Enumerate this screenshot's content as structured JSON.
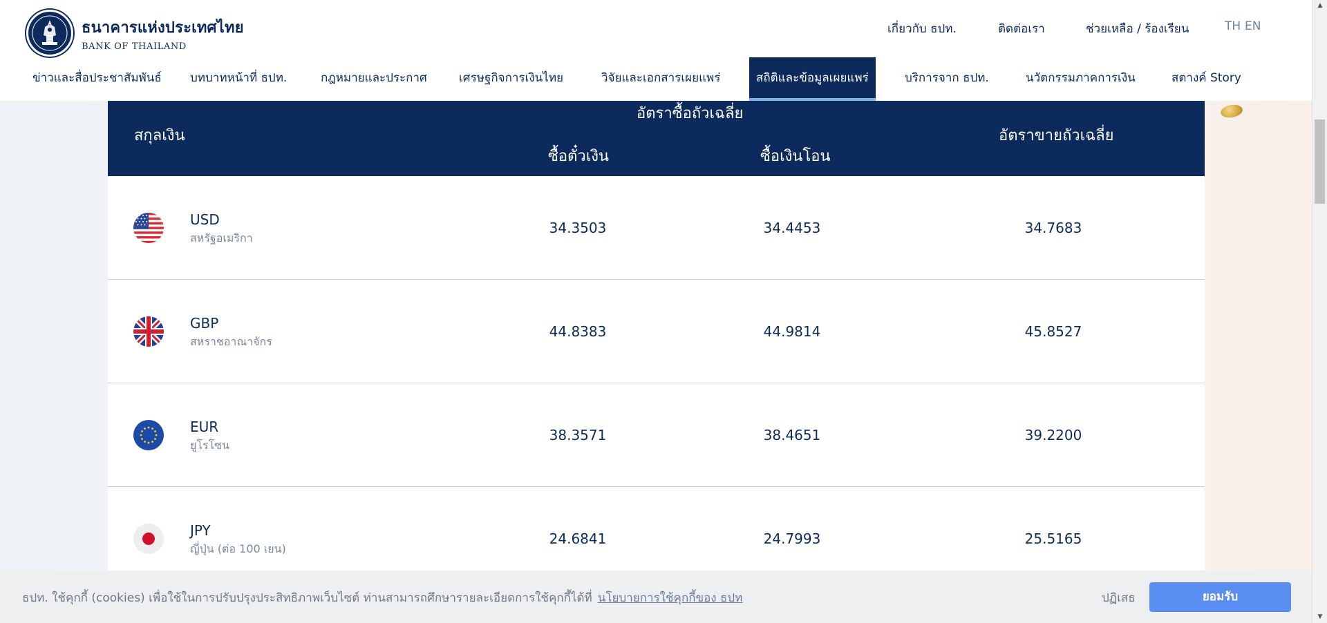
{
  "header": {
    "logo_th": "ธนาคารแห่งประเทศไทย",
    "logo_en": "BANK OF THAILAND",
    "top_links": [
      "เกี่ยวกับ ธปท.",
      "ติดต่อเรา",
      "ช่วยเหลือ / ร้องเรียน"
    ],
    "lang_th": "TH",
    "lang_en": "EN"
  },
  "nav": {
    "items": [
      "ข่าวและสื่อประชาสัมพันธ์",
      "บทบาทหน้าที่ ธปท.",
      "กฎหมายและประกาศ",
      "เศรษฐกิจการเงินไทย",
      "วิจัยและเอกสารเผยแพร่",
      "สถิติและข้อมูลเผยแพร่",
      "บริการจาก ธปท.",
      "นวัตกรรมภาคการเงิน",
      "สตางค์ Story"
    ],
    "active_index": 5
  },
  "table": {
    "headers": {
      "currency": "สกุลเงิน",
      "avg_buying": "อัตราซื้อถัวเฉลี่ย",
      "sight_bill": "ซื้อตั๋วเงิน",
      "transfer": "ซื้อเงินโอน",
      "avg_selling": "อัตราขายถัวเฉลี่ย"
    },
    "rows": [
      {
        "code": "USD",
        "name": "สหรัฐอเมริกา",
        "sight_bill": "34.3503",
        "transfer": "34.4453",
        "selling": "34.7683",
        "flag": "us-flag"
      },
      {
        "code": "GBP",
        "name": "สหราชอาณาจักร",
        "sight_bill": "44.8383",
        "transfer": "44.9814",
        "selling": "45.8527",
        "flag": "uk-flag"
      },
      {
        "code": "EUR",
        "name": "ยูโรโซน",
        "sight_bill": "38.3571",
        "transfer": "38.4651",
        "selling": "39.2200",
        "flag": "eu-flag"
      },
      {
        "code": "JPY",
        "name": "ญี่ปุ่น (ต่อ 100 เยน)",
        "sight_bill": "24.6841",
        "transfer": "24.7993",
        "selling": "25.5165",
        "flag": "jp-flag"
      }
    ]
  },
  "cookie": {
    "text": "ธปท. ใช้คุกกี้ (cookies) เพื่อใช้ในการปรับปรุงประสิทธิภาพเว็บไซต์ ท่านสามารถศึกษารายละเอียดการใช้คุกกี้ได้ที่",
    "link": "นโยบายการใช้คุกกี้ของ ธปท",
    "decline": "ปฏิเสธ",
    "accept": "ยอมรับ"
  },
  "colors": {
    "primary": "#0c2a5b",
    "accent": "#5a8ef0",
    "active_underline": "#7fb2e6"
  }
}
